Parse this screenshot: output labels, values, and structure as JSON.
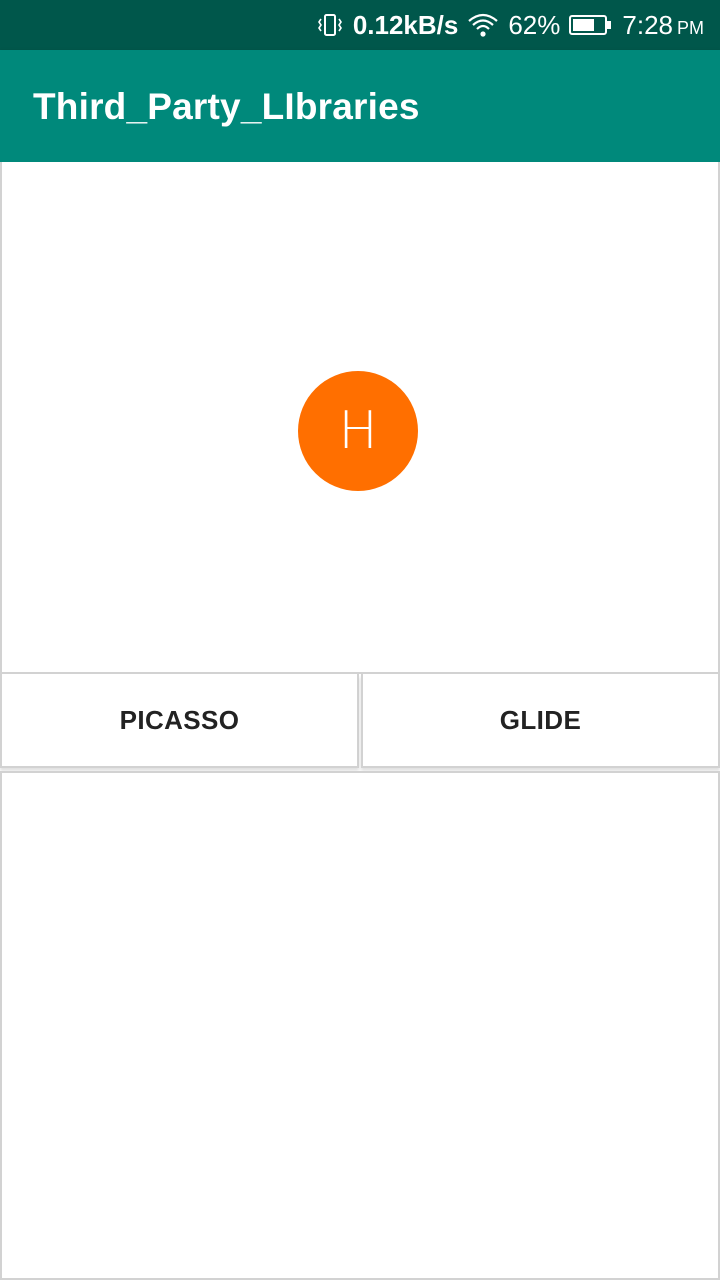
{
  "status_bar": {
    "network_speed": "0.12kB/s",
    "battery_percent": "62%",
    "time": "7:28",
    "am_pm": "PM",
    "icons": [
      "vibrate-icon",
      "wifi-icon",
      "battery-icon"
    ]
  },
  "app_bar": {
    "title": "Third_Party_LIbraries",
    "color": "#00897b"
  },
  "image_view": {
    "avatar_letter": "H",
    "avatar_color": "#ff6f00"
  },
  "buttons": {
    "picasso_label": "PICASSO",
    "glide_label": "GLIDE"
  }
}
